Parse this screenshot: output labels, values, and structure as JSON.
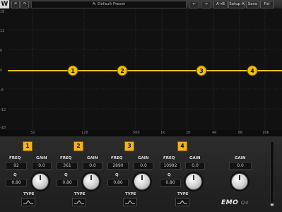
{
  "toolbar": {
    "logo": "W",
    "undo_label": "↶",
    "redo_label": "↷",
    "preset_name": "A: Default Preset",
    "prev_label": "←",
    "next_label": "→",
    "ab_label": "A→B",
    "setup_label": "Setup A",
    "save_label": "Save",
    "file_label": "Fst"
  },
  "graph": {
    "y_labels": [
      "18",
      "12",
      "6",
      "0",
      "-6",
      "-12",
      "-18"
    ],
    "x_labels": [
      "32",
      "128",
      "500",
      "1K",
      "2K",
      "4K",
      "8K",
      "16K"
    ],
    "curve_color": "#f2c300",
    "nodes": [
      "1",
      "2",
      "3",
      "4"
    ]
  },
  "bands": [
    {
      "number": "1",
      "freq_label": "FREQ",
      "freq": "92",
      "gain_label": "GAIN",
      "gain": "0.0",
      "q_label": "Q",
      "q": "0.80",
      "type_label": "TYPE"
    },
    {
      "number": "2",
      "freq_label": "FREQ",
      "freq": "361",
      "gain_label": "GAIN",
      "gain": "0.0",
      "q_label": "Q",
      "q": "0.80",
      "type_label": "TYPE"
    },
    {
      "number": "3",
      "freq_label": "FREQ",
      "freq": "2890",
      "gain_label": "GAIN",
      "gain": "0.0",
      "q_label": "Q",
      "q": "0.80",
      "type_label": "TYPE"
    },
    {
      "number": "4",
      "freq_label": "FREQ",
      "freq": "10992",
      "gain_label": "GAIN",
      "gain": "0.0",
      "q_label": "Q",
      "q": "0.80",
      "type_label": "TYPE"
    }
  ],
  "output": {
    "gain_label": "GAIN",
    "gain": "0.0"
  },
  "meter": {
    "level_fraction": 0.03
  },
  "brand": {
    "name": "EMO",
    "model": "Q4"
  }
}
